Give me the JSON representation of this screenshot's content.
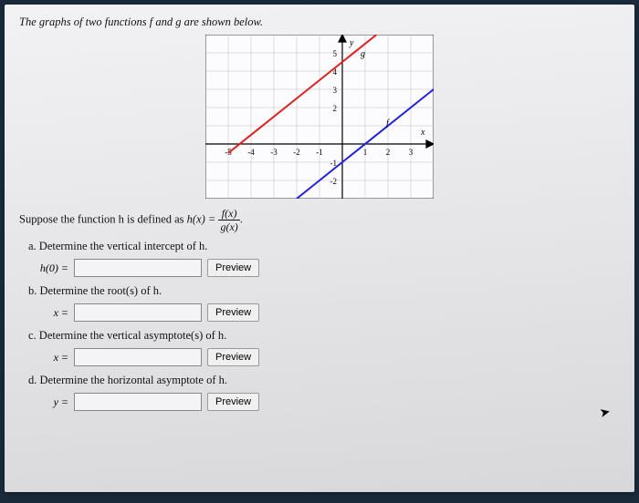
{
  "intro": "The graphs of two functions f and g are shown below.",
  "definition_prefix": "Suppose the function h is defined as ",
  "definition_lhs": "h(x) = ",
  "fraction": {
    "top": "f(x)",
    "bot": "g(x)"
  },
  "questions": {
    "a": {
      "text": "a. Determine the vertical intercept of h.",
      "label": "h(0) = ",
      "button": "Preview"
    },
    "b": {
      "text": "b. Determine the root(s) of h.",
      "label": "x = ",
      "button": "Preview"
    },
    "c": {
      "text": "c. Determine the vertical asymptote(s) of h.",
      "label": "x = ",
      "button": "Preview"
    },
    "d": {
      "text": "d. Determine the horizontal asymptote of h.",
      "label": "y = ",
      "button": "Preview"
    }
  },
  "chart_data": {
    "type": "line",
    "xlim": [
      -5,
      3
    ],
    "ylim": [
      -2,
      5
    ],
    "axis_labels": {
      "x": "x",
      "y": "y"
    },
    "x_ticks": [
      -5,
      -4,
      -3,
      -2,
      -1,
      1,
      2,
      3
    ],
    "y_ticks": [
      -2,
      -1,
      2,
      3,
      4,
      5
    ],
    "series": [
      {
        "name": "g",
        "color": "#d22",
        "points": [
          [
            -5,
            -0.5
          ],
          [
            3,
            7.5
          ]
        ],
        "label_at": [
          0.7,
          4.5
        ]
      },
      {
        "name": "f",
        "color": "#22d",
        "points": [
          [
            -2,
            -3
          ],
          [
            5,
            4
          ]
        ],
        "label_at": [
          1.8,
          1
        ]
      }
    ]
  }
}
